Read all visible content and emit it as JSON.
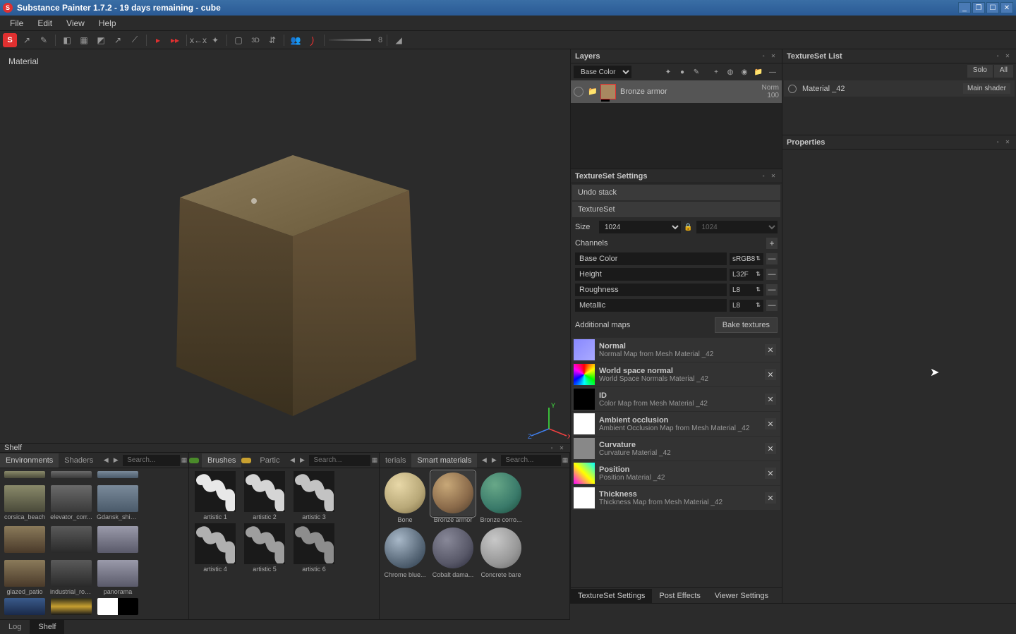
{
  "titlebar": {
    "text": "Substance Painter 1.7.2 - 19 days remaining - cube"
  },
  "menu": [
    "File",
    "Edit",
    "View",
    "Help"
  ],
  "toolbar": {
    "slider_value": "8"
  },
  "viewport": {
    "label": "Material",
    "axis": {
      "x": "X",
      "y": "Y",
      "z": "Z"
    }
  },
  "layers": {
    "title": "Layers",
    "channel": "Base Color",
    "items": [
      {
        "name": "Bronze armor",
        "blend": "Norm",
        "opacity": "100"
      }
    ]
  },
  "ts_settings": {
    "title": "TextureSet Settings",
    "undo": "Undo stack",
    "textureset_label": "TextureSet",
    "size_label": "Size",
    "size_a": "1024",
    "size_b": "1024",
    "channels_label": "Channels",
    "channels": [
      {
        "name": "Base Color",
        "fmt": "sRGB8"
      },
      {
        "name": "Height",
        "fmt": "L32F"
      },
      {
        "name": "Roughness",
        "fmt": "L8"
      },
      {
        "name": "Metallic",
        "fmt": "L8"
      }
    ],
    "additional_maps_label": "Additional maps",
    "bake_label": "Bake textures",
    "maps": [
      {
        "name": "Normal",
        "desc": "Normal Map from Mesh Material _42",
        "color": "linear-gradient(135deg,#8888ff,#aaaaff)"
      },
      {
        "name": "World space normal",
        "desc": "World Space Normals Material _42",
        "color": "conic-gradient(#f00,#ff0,#0f0,#0ff,#00f,#f0f,#f00)"
      },
      {
        "name": "ID",
        "desc": "Color Map from Mesh Material _42",
        "color": "#000"
      },
      {
        "name": "Ambient occlusion",
        "desc": "Ambient Occlusion Map from Mesh Material _42",
        "color": "#fff"
      },
      {
        "name": "Curvature",
        "desc": "Curvature Material _42",
        "color": "#888"
      },
      {
        "name": "Position",
        "desc": "Position Material _42",
        "color": "linear-gradient(45deg,#f0f,#ff0,#0ff)"
      },
      {
        "name": "Thickness",
        "desc": "Thickness Map from Mesh Material _42",
        "color": "#fff"
      }
    ],
    "tabs": [
      "TextureSet Settings",
      "Post Effects",
      "Viewer Settings"
    ]
  },
  "tslist": {
    "title": "TextureSet List",
    "solo": "Solo",
    "all": "All",
    "items": [
      {
        "name": "Material _42",
        "shader": "Main shader"
      }
    ]
  },
  "properties": {
    "title": "Properties"
  },
  "shelf": {
    "title": "Shelf",
    "search_placeholder": "Search...",
    "footer_tabs": [
      "Log",
      "Shelf"
    ],
    "col1": {
      "tabs": [
        "Environments",
        "Shaders"
      ],
      "items": [
        "corsica_beach",
        "elevator_corr...",
        "Gdansk_ship...",
        "glazed_patio",
        "industrial_room",
        "panorama"
      ]
    },
    "col2": {
      "tabs": [
        "Brushes",
        "Partic"
      ],
      "items": [
        "artistic 1",
        "artistic 2",
        "artistic 3",
        "artistic 4",
        "artistic 5",
        "artistic 6"
      ]
    },
    "col3": {
      "tabs": [
        "terials",
        "Smart materials"
      ],
      "items": [
        {
          "label": "Bone",
          "c": "radial-gradient(circle at 35% 30%, #e8d8a8, #b8a878 60%, #786840)"
        },
        {
          "label": "Bronze armor",
          "c": "radial-gradient(circle at 35% 30%, #c8a878, #8a6a4a 60%, #4a3a2a)"
        },
        {
          "label": "Bronze corro...",
          "c": "radial-gradient(circle at 35% 30%, #68a888, #3a7a6a 60%, #1a4a3a)"
        },
        {
          "label": "Chrome blue...",
          "c": "radial-gradient(circle at 35% 30%, #a8b8c8, #586878 60%, #283848)"
        },
        {
          "label": "Cobalt dama...",
          "c": "radial-gradient(circle at 35% 30%, #888898, #585868 60%, #282838)"
        },
        {
          "label": "Concrete bare",
          "c": "radial-gradient(circle at 35% 30%, #c8c8c8, #989898 60%, #686868)"
        }
      ]
    }
  }
}
